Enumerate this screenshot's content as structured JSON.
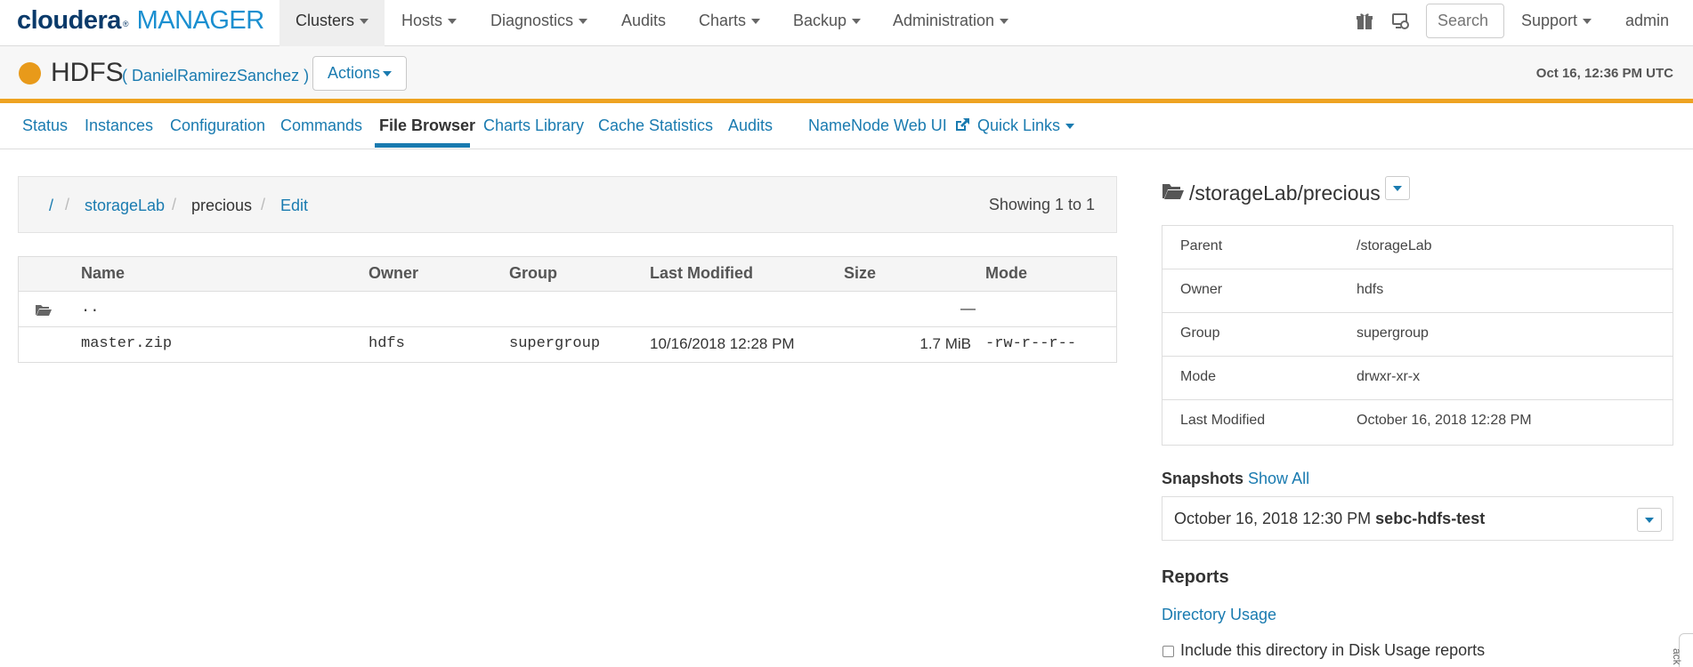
{
  "logo": {
    "brand": "cloudera",
    "product": "MANAGER"
  },
  "nav": {
    "items": [
      {
        "label": "Clusters",
        "dropdown": true,
        "active": true
      },
      {
        "label": "Hosts",
        "dropdown": true
      },
      {
        "label": "Diagnostics",
        "dropdown": true
      },
      {
        "label": "Audits",
        "dropdown": false
      },
      {
        "label": "Charts",
        "dropdown": true
      },
      {
        "label": "Backup",
        "dropdown": true
      },
      {
        "label": "Administration",
        "dropdown": true
      }
    ],
    "search_placeholder": "Search",
    "support": "Support",
    "user": "admin"
  },
  "service": {
    "name": "HDFS",
    "cluster": "( DanielRamirezSanchez )",
    "actions_label": "Actions",
    "timestamp": "Oct 16, 12:36 PM UTC",
    "status_color": "#e89a1a"
  },
  "tabs": [
    {
      "label": "Status"
    },
    {
      "label": "Instances"
    },
    {
      "label": "Configuration"
    },
    {
      "label": "Commands"
    },
    {
      "label": "File Browser",
      "active": true
    },
    {
      "label": "Charts Library"
    },
    {
      "label": "Cache Statistics"
    },
    {
      "label": "Audits"
    },
    {
      "label": "NameNode Web UI",
      "external": true
    },
    {
      "label": "Quick Links",
      "dropdown": true
    }
  ],
  "breadcrumb": {
    "root": "/",
    "items": [
      "storageLab",
      "precious"
    ],
    "edit": "Edit",
    "showing": "Showing 1 to 1"
  },
  "files": {
    "columns": [
      "Name",
      "Owner",
      "Group",
      "Last Modified",
      "Size",
      "Mode"
    ],
    "parent": {
      "name": "..",
      "size": "—"
    },
    "rows": [
      {
        "name": "master.zip",
        "owner": "hdfs",
        "group": "supergroup",
        "modified": "10/16/2018 12:28 PM",
        "size": "1.7 MiB",
        "mode": "-rw-r--r--"
      }
    ]
  },
  "details": {
    "path": "/storageLab/precious",
    "props": [
      {
        "key": "Parent",
        "value": "/storageLab"
      },
      {
        "key": "Owner",
        "value": "hdfs"
      },
      {
        "key": "Group",
        "value": "supergroup"
      },
      {
        "key": "Mode",
        "value": "drwxr-xr-x"
      },
      {
        "key": "Last Modified",
        "value": "October 16, 2018 12:28 PM"
      }
    ],
    "snapshots_label": "Snapshots",
    "show_all": "Show All",
    "snapshot": {
      "time": "October 16, 2018 12:30 PM",
      "name": "sebc-hdfs-test"
    },
    "reports_label": "Reports",
    "directory_usage": "Directory Usage",
    "include_label": "Include this directory in Disk Usage reports"
  },
  "side_tab": "ack"
}
